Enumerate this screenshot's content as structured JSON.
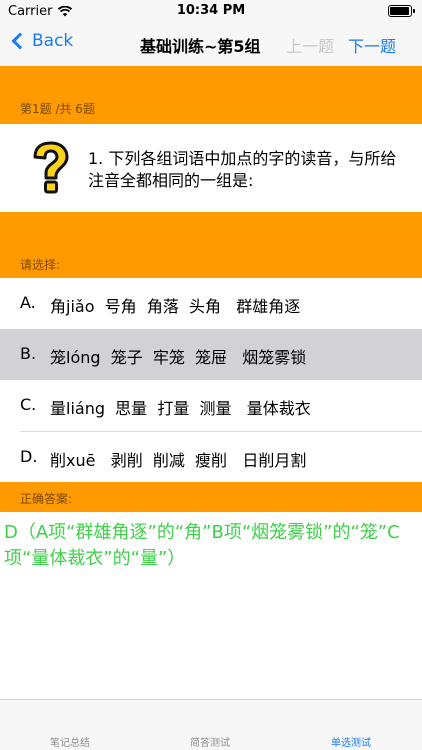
{
  "status": {
    "carrier": "Carrier",
    "time": "10:34 PM",
    "battery_level": 0.95
  },
  "nav": {
    "back": "Back",
    "title": "基础训练~第5组",
    "prev": "上一题",
    "next": "下一题"
  },
  "progress": {
    "text": "第1题 /共 6题"
  },
  "question": {
    "icon": "question-mark-icon",
    "text": "1.  下列各组词语中加点的字的读音，与所给注音全都相同的一组是:"
  },
  "choose_label": "请选择:",
  "options": [
    {
      "letter": "A.",
      "words": "角jiǎo  号角  角落  头角   群雄角逐",
      "selected": false
    },
    {
      "letter": "B.",
      "words": "笼lóng  笼子  牢笼  笼屉   烟笼雾锁",
      "selected": true
    },
    {
      "letter": "C.",
      "words": "量liáng  思量  打量  测量   量体裁衣",
      "selected": false
    },
    {
      "letter": "D.",
      "words": "削xuē   剥削  削减  瘦削   日削月割",
      "selected": false
    }
  ],
  "answer_label": "正确答案:",
  "answer_text": "D（A项“群雄角逐”的“角”B项“烟笼雾锁”的“笼”C项“量体裁衣”的“量”）",
  "tabs": [
    {
      "label": "笔记总结",
      "active": false
    },
    {
      "label": "简答测试",
      "active": false
    },
    {
      "label": "单选测试",
      "active": true
    }
  ],
  "colors": {
    "accent": "#1a7cf2",
    "band": "#ff9a00",
    "answer": "#3fd04a",
    "selected": "#d1d1d6"
  }
}
